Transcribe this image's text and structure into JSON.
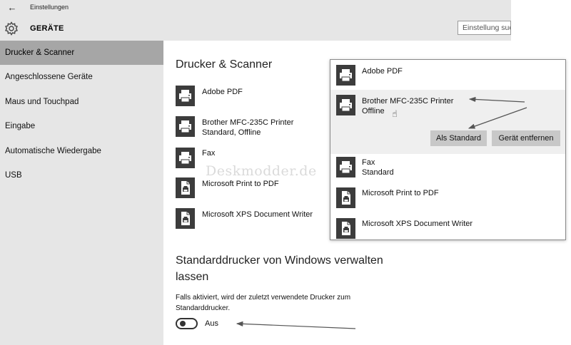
{
  "window": {
    "title": "Einstellungen",
    "back_icon": "back-arrow-icon"
  },
  "header": {
    "section_title": "GERÄTE",
    "section_icon": "gear-icon",
    "search_placeholder": "Einstellung suchen"
  },
  "sidebar": {
    "items": [
      {
        "label": "Drucker & Scanner",
        "selected": true
      },
      {
        "label": "Angeschlossene Geräte"
      },
      {
        "label": "Maus und Touchpad"
      },
      {
        "label": "Eingabe"
      },
      {
        "label": "Automatische Wiedergabe"
      },
      {
        "label": "USB"
      }
    ]
  },
  "main": {
    "title": "Drucker & Scanner",
    "printers": [
      {
        "name": "Adobe PDF",
        "status": ""
      },
      {
        "name": "Brother MFC-235C Printer",
        "status": "Standard, Offline"
      },
      {
        "name": "Fax",
        "status": ""
      },
      {
        "name": "Microsoft Print to PDF",
        "status": ""
      },
      {
        "name": "Microsoft XPS Document Writer",
        "status": ""
      }
    ],
    "watermark": "Deskmodder.de",
    "default_title": "Standarddrucker von Windows verwalten lassen",
    "default_desc": "Falls aktiviert, wird der zuletzt verwendete Drucker zum Standarddrucker.",
    "toggle_label": "Aus",
    "toggle_on": false
  },
  "popup": {
    "items": [
      {
        "name": "Adobe PDF",
        "status": ""
      },
      {
        "name": "Brother MFC-235C Printer",
        "status": "Offline",
        "expanded": true
      },
      {
        "name": "Fax",
        "status": "Standard"
      },
      {
        "name": "Microsoft Print to PDF",
        "status": ""
      },
      {
        "name": "Microsoft XPS Document Writer",
        "status": ""
      }
    ],
    "set_default_label": "Als Standard",
    "remove_label": "Gerät entfernen"
  },
  "colors": {
    "pane": "#e6e6e6",
    "selected": "#a6a6a6",
    "button": "#c8c8c8",
    "popup_selected": "#efefef"
  }
}
